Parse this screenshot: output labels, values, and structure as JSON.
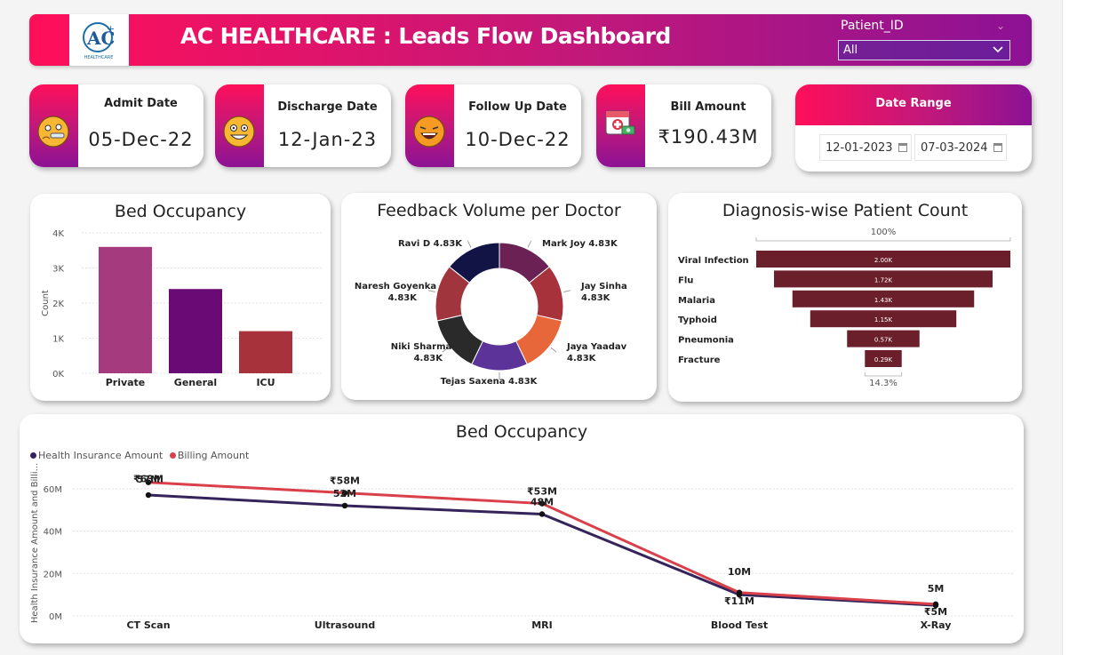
{
  "header": {
    "title": "AC HEALTHCARE : Leads Flow Dashboard",
    "logo_text": "AC",
    "logo_sub": "HEALTHCARE"
  },
  "slicer": {
    "label": "Patient_ID",
    "value": "All"
  },
  "kpis": [
    {
      "label": "Admit Date",
      "value": "05-Dec-22",
      "icon": "sick-face-icon"
    },
    {
      "label": "Discharge Date",
      "value": "12-Jan-23",
      "icon": "happy-face-icon"
    },
    {
      "label": "Follow Up Date",
      "value": "10-Dec-22",
      "icon": "laughing-face-icon"
    },
    {
      "label": "Bill Amount",
      "value": "₹190.43M",
      "icon": "medical-bill-icon"
    }
  ],
  "date_range": {
    "title": "Date Range",
    "from": "12-01-2023",
    "to": "07-03-2024"
  },
  "colors": {
    "accent_pink": "#ff0f5a",
    "accent_purple": "#8c1294",
    "funnel": "#6b1f2a",
    "line_insurance": "#34245a",
    "line_billing": "#d9404a"
  },
  "chart_data": [
    {
      "type": "bar",
      "title": "Bed Occupancy",
      "ylabel": "Count",
      "categories": [
        "Private",
        "General",
        "ICU"
      ],
      "values": [
        3600,
        2400,
        1200
      ],
      "colors": [
        "#a63a7e",
        "#6a0a75",
        "#a8323c"
      ],
      "ylim": [
        0,
        4000
      ],
      "yticks": [
        "0K",
        "1K",
        "2K",
        "3K",
        "4K"
      ]
    },
    {
      "type": "pie",
      "title": "Feedback Volume per Doctor",
      "slices": [
        {
          "name": "Mark Joy",
          "value": 4.83,
          "label": "4.83K",
          "color": "#6b2154"
        },
        {
          "name": "Jay Sinha",
          "value": 4.83,
          "label": "4.83K",
          "color": "#a8323c"
        },
        {
          "name": "Jaya Yaadav",
          "value": 4.83,
          "label": "4.83K",
          "color": "#e8673a"
        },
        {
          "name": "Tejas Saxena",
          "value": 4.83,
          "label": "4.83K",
          "color": "#5b3399"
        },
        {
          "name": "Niki Sharma",
          "value": 4.83,
          "label": "4.83K",
          "color": "#2a2a2a"
        },
        {
          "name": "Naresh Goyenka",
          "value": 4.83,
          "label": "4.83K",
          "color": "#a0353e"
        },
        {
          "name": "Ravi D",
          "value": 4.83,
          "label": "4.83K",
          "color": "#121445"
        }
      ]
    },
    {
      "type": "bar",
      "title": "Diagnosis-wise Patient Count",
      "top_label": "100%",
      "bottom_label": "14.3%",
      "categories": [
        "Viral Infection",
        "Flu",
        "Malaria",
        "Typhoid",
        "Pneumonia",
        "Fracture"
      ],
      "values": [
        2000,
        1720,
        1430,
        1150,
        570,
        290
      ],
      "labels": [
        "2.00K",
        "1.72K",
        "1.43K",
        "1.15K",
        "0.57K",
        "0.29K"
      ]
    },
    {
      "type": "line",
      "title": "Bed Occupancy",
      "ylabel": "Health Insurance Amount and Billi...",
      "categories": [
        "CT Scan",
        "Ultrasound",
        "MRI",
        "Blood Test",
        "X-Ray"
      ],
      "ylim": [
        0,
        70
      ],
      "yticks": [
        "0M",
        "20M",
        "40M",
        "60M"
      ],
      "series": [
        {
          "name": "Health Insurance Amount",
          "values": [
            57,
            52,
            48,
            10,
            5
          ],
          "labels": [
            "57M",
            "52M",
            "48M",
            "10M",
            "5M"
          ],
          "color": "#34245a"
        },
        {
          "name": "Billing Amount",
          "values": [
            63,
            58,
            53,
            11,
            5.5
          ],
          "labels": [
            "₹63M",
            "₹58M",
            "₹53M",
            "₹11M",
            "₹5M"
          ],
          "color": "#d9404a"
        }
      ]
    }
  ]
}
